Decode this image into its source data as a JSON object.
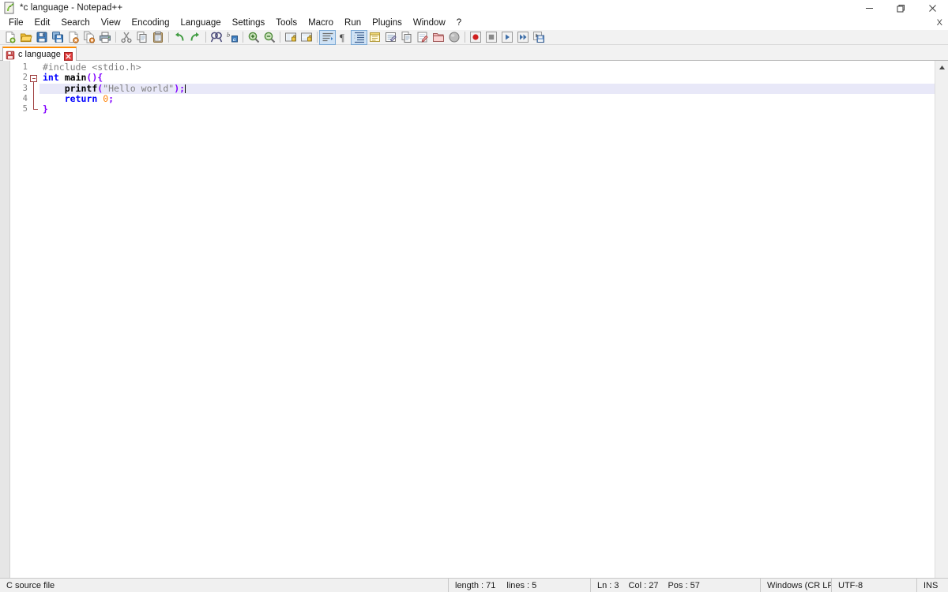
{
  "window": {
    "title": "*c language - Notepad++",
    "app_icon": "notepad-plus-plus-icon",
    "controls": {
      "minimize": "─",
      "restore": "❐",
      "close": "✕"
    }
  },
  "menubar": {
    "items": [
      "File",
      "Edit",
      "Search",
      "View",
      "Encoding",
      "Language",
      "Settings",
      "Tools",
      "Macro",
      "Run",
      "Plugins",
      "Window",
      "?"
    ],
    "document_close": "X"
  },
  "toolbar": {
    "groups": [
      [
        {
          "name": "new-file-icon",
          "title": "New"
        },
        {
          "name": "open-file-icon",
          "title": "Open"
        },
        {
          "name": "save-icon",
          "title": "Save"
        },
        {
          "name": "save-all-icon",
          "title": "Save All"
        },
        {
          "name": "close-file-icon",
          "title": "Close"
        },
        {
          "name": "close-all-icon",
          "title": "Close All"
        },
        {
          "name": "print-icon",
          "title": "Print"
        }
      ],
      [
        {
          "name": "cut-icon",
          "title": "Cut"
        },
        {
          "name": "copy-icon",
          "title": "Copy"
        },
        {
          "name": "paste-icon",
          "title": "Paste"
        }
      ],
      [
        {
          "name": "undo-icon",
          "title": "Undo"
        },
        {
          "name": "redo-icon",
          "title": "Redo"
        }
      ],
      [
        {
          "name": "find-icon",
          "title": "Find"
        },
        {
          "name": "replace-icon",
          "title": "Replace"
        }
      ],
      [
        {
          "name": "zoom-in-icon",
          "title": "Zoom In"
        },
        {
          "name": "zoom-out-icon",
          "title": "Zoom Out"
        }
      ],
      [
        {
          "name": "sync-vertical-scroll-icon",
          "title": "Synchronize Vertical Scrolling"
        },
        {
          "name": "sync-horizontal-scroll-icon",
          "title": "Synchronize Horizontal Scrolling"
        }
      ],
      [
        {
          "name": "word-wrap-icon",
          "title": "Word wrap"
        },
        {
          "name": "show-all-chars-icon",
          "title": "Show All Characters"
        },
        {
          "name": "indent-guide-icon",
          "title": "Show Indent Guide"
        },
        {
          "name": "show-ui-icon",
          "title": "Show UI"
        },
        {
          "name": "user-defined-dlg-icon",
          "title": "User Defined Dialogue"
        },
        {
          "name": "document-map-icon",
          "title": "Document Map"
        },
        {
          "name": "function-list-icon",
          "title": "Function List"
        },
        {
          "name": "folder-workspace-icon",
          "title": "Folder as Workspace"
        },
        {
          "name": "monitoring-icon",
          "title": "Monitoring"
        }
      ],
      [
        {
          "name": "macro-record-icon",
          "title": "Start Recording"
        },
        {
          "name": "macro-stop-icon",
          "title": "Stop Recording"
        },
        {
          "name": "macro-play-icon",
          "title": "Playback"
        },
        {
          "name": "macro-play-multi-icon",
          "title": "Run a Macro Multiple Times"
        },
        {
          "name": "macro-save-icon",
          "title": "Save Current Recorded Macro"
        }
      ]
    ]
  },
  "tabs": [
    {
      "label": "c language",
      "icon": "unsaved-floppy-icon",
      "close_icon": "tab-close-icon",
      "active": true,
      "modified": true
    }
  ],
  "editor": {
    "line_numbers": [
      "1",
      "2",
      "3",
      "4",
      "5"
    ],
    "current_line": 3,
    "fold_open_line": 2,
    "lines": [
      {
        "number": 1,
        "tokens": [
          {
            "text": "#include ",
            "color": "#808080",
            "bold": false
          },
          {
            "text": "<stdio.h>",
            "color": "#808080",
            "bold": false
          }
        ]
      },
      {
        "number": 2,
        "tokens": [
          {
            "text": "int",
            "color": "#0000ff",
            "bold": true
          },
          {
            "text": " ",
            "color": "#000000",
            "bold": false
          },
          {
            "text": "main",
            "color": "#000000",
            "bold": true
          },
          {
            "text": "(){",
            "color": "#8000ff",
            "bold": true
          }
        ]
      },
      {
        "number": 3,
        "tokens": [
          {
            "text": "    ",
            "color": "#000000",
            "bold": false
          },
          {
            "text": "printf",
            "color": "#000000",
            "bold": true
          },
          {
            "text": "(",
            "color": "#8000ff",
            "bold": true
          },
          {
            "text": "\"Hello world\"",
            "color": "#808080",
            "bold": false
          },
          {
            "text": ")",
            "color": "#8000ff",
            "bold": true
          },
          {
            "text": ";",
            "color": "#8000ff",
            "bold": true
          }
        ]
      },
      {
        "number": 4,
        "tokens": [
          {
            "text": "    ",
            "color": "#000000",
            "bold": false
          },
          {
            "text": "return",
            "color": "#0000ff",
            "bold": true
          },
          {
            "text": " ",
            "color": "#000000",
            "bold": false
          },
          {
            "text": "0",
            "color": "#ff8000",
            "bold": false
          },
          {
            "text": ";",
            "color": "#8000ff",
            "bold": true
          }
        ]
      },
      {
        "number": 5,
        "tokens": [
          {
            "text": "}",
            "color": "#8000ff",
            "bold": true
          }
        ]
      }
    ],
    "current_line_highlight": "#e8e8f8",
    "fold_color": "#a04040",
    "scroll_up_icon": "scroll-up-arrow-icon"
  },
  "statusbar": {
    "doc_type": "C source file",
    "length_label": "length : 71",
    "lines_label": "lines : 5",
    "ln_label": "Ln : 3",
    "col_label": "Col : 27",
    "pos_label": "Pos : 57",
    "eol": "Windows (CR LF)",
    "encoding": "UTF-8",
    "insert_mode": "INS"
  }
}
